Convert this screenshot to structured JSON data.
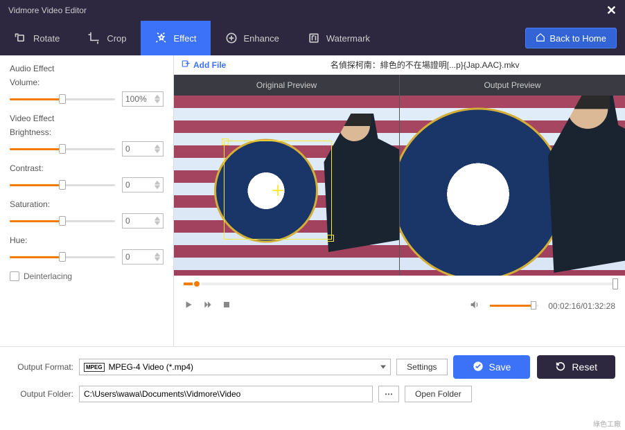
{
  "window": {
    "title": "Vidmore Video Editor"
  },
  "toolbar": {
    "rotate": "Rotate",
    "crop": "Crop",
    "effect": "Effect",
    "enhance": "Enhance",
    "watermark": "Watermark",
    "back_home": "Back to Home"
  },
  "sidebar": {
    "audio_effect": "Audio Effect",
    "volume_label": "Volume:",
    "volume_value": "100%",
    "volume_pct": 50,
    "video_effect": "Video Effect",
    "brightness_label": "Brightness:",
    "brightness_value": "0",
    "contrast_label": "Contrast:",
    "contrast_value": "0",
    "saturation_label": "Saturation:",
    "saturation_value": "0",
    "hue_label": "Hue:",
    "hue_value": "0",
    "deinterlacing": "Deinterlacing"
  },
  "filebar": {
    "add_file": "Add File",
    "filename": "名偵探柯南：緋色的不在場證明[...p}{Jap.AAC}.mkv"
  },
  "preview": {
    "original": "Original Preview",
    "output": "Output Preview"
  },
  "playback": {
    "time": "00:02:16/01:32:28",
    "seek_pct": 3,
    "volume_pct": 90
  },
  "bottom": {
    "output_format_label": "Output Format:",
    "output_format_value": "MPEG-4 Video (*.mp4)",
    "settings": "Settings",
    "output_folder_label": "Output Folder:",
    "output_folder_value": "C:\\Users\\wawa\\Documents\\Vidmore\\Video",
    "open_folder": "Open Folder",
    "save": "Save",
    "reset": "Reset"
  },
  "footer_watermark": "綠色工廠"
}
